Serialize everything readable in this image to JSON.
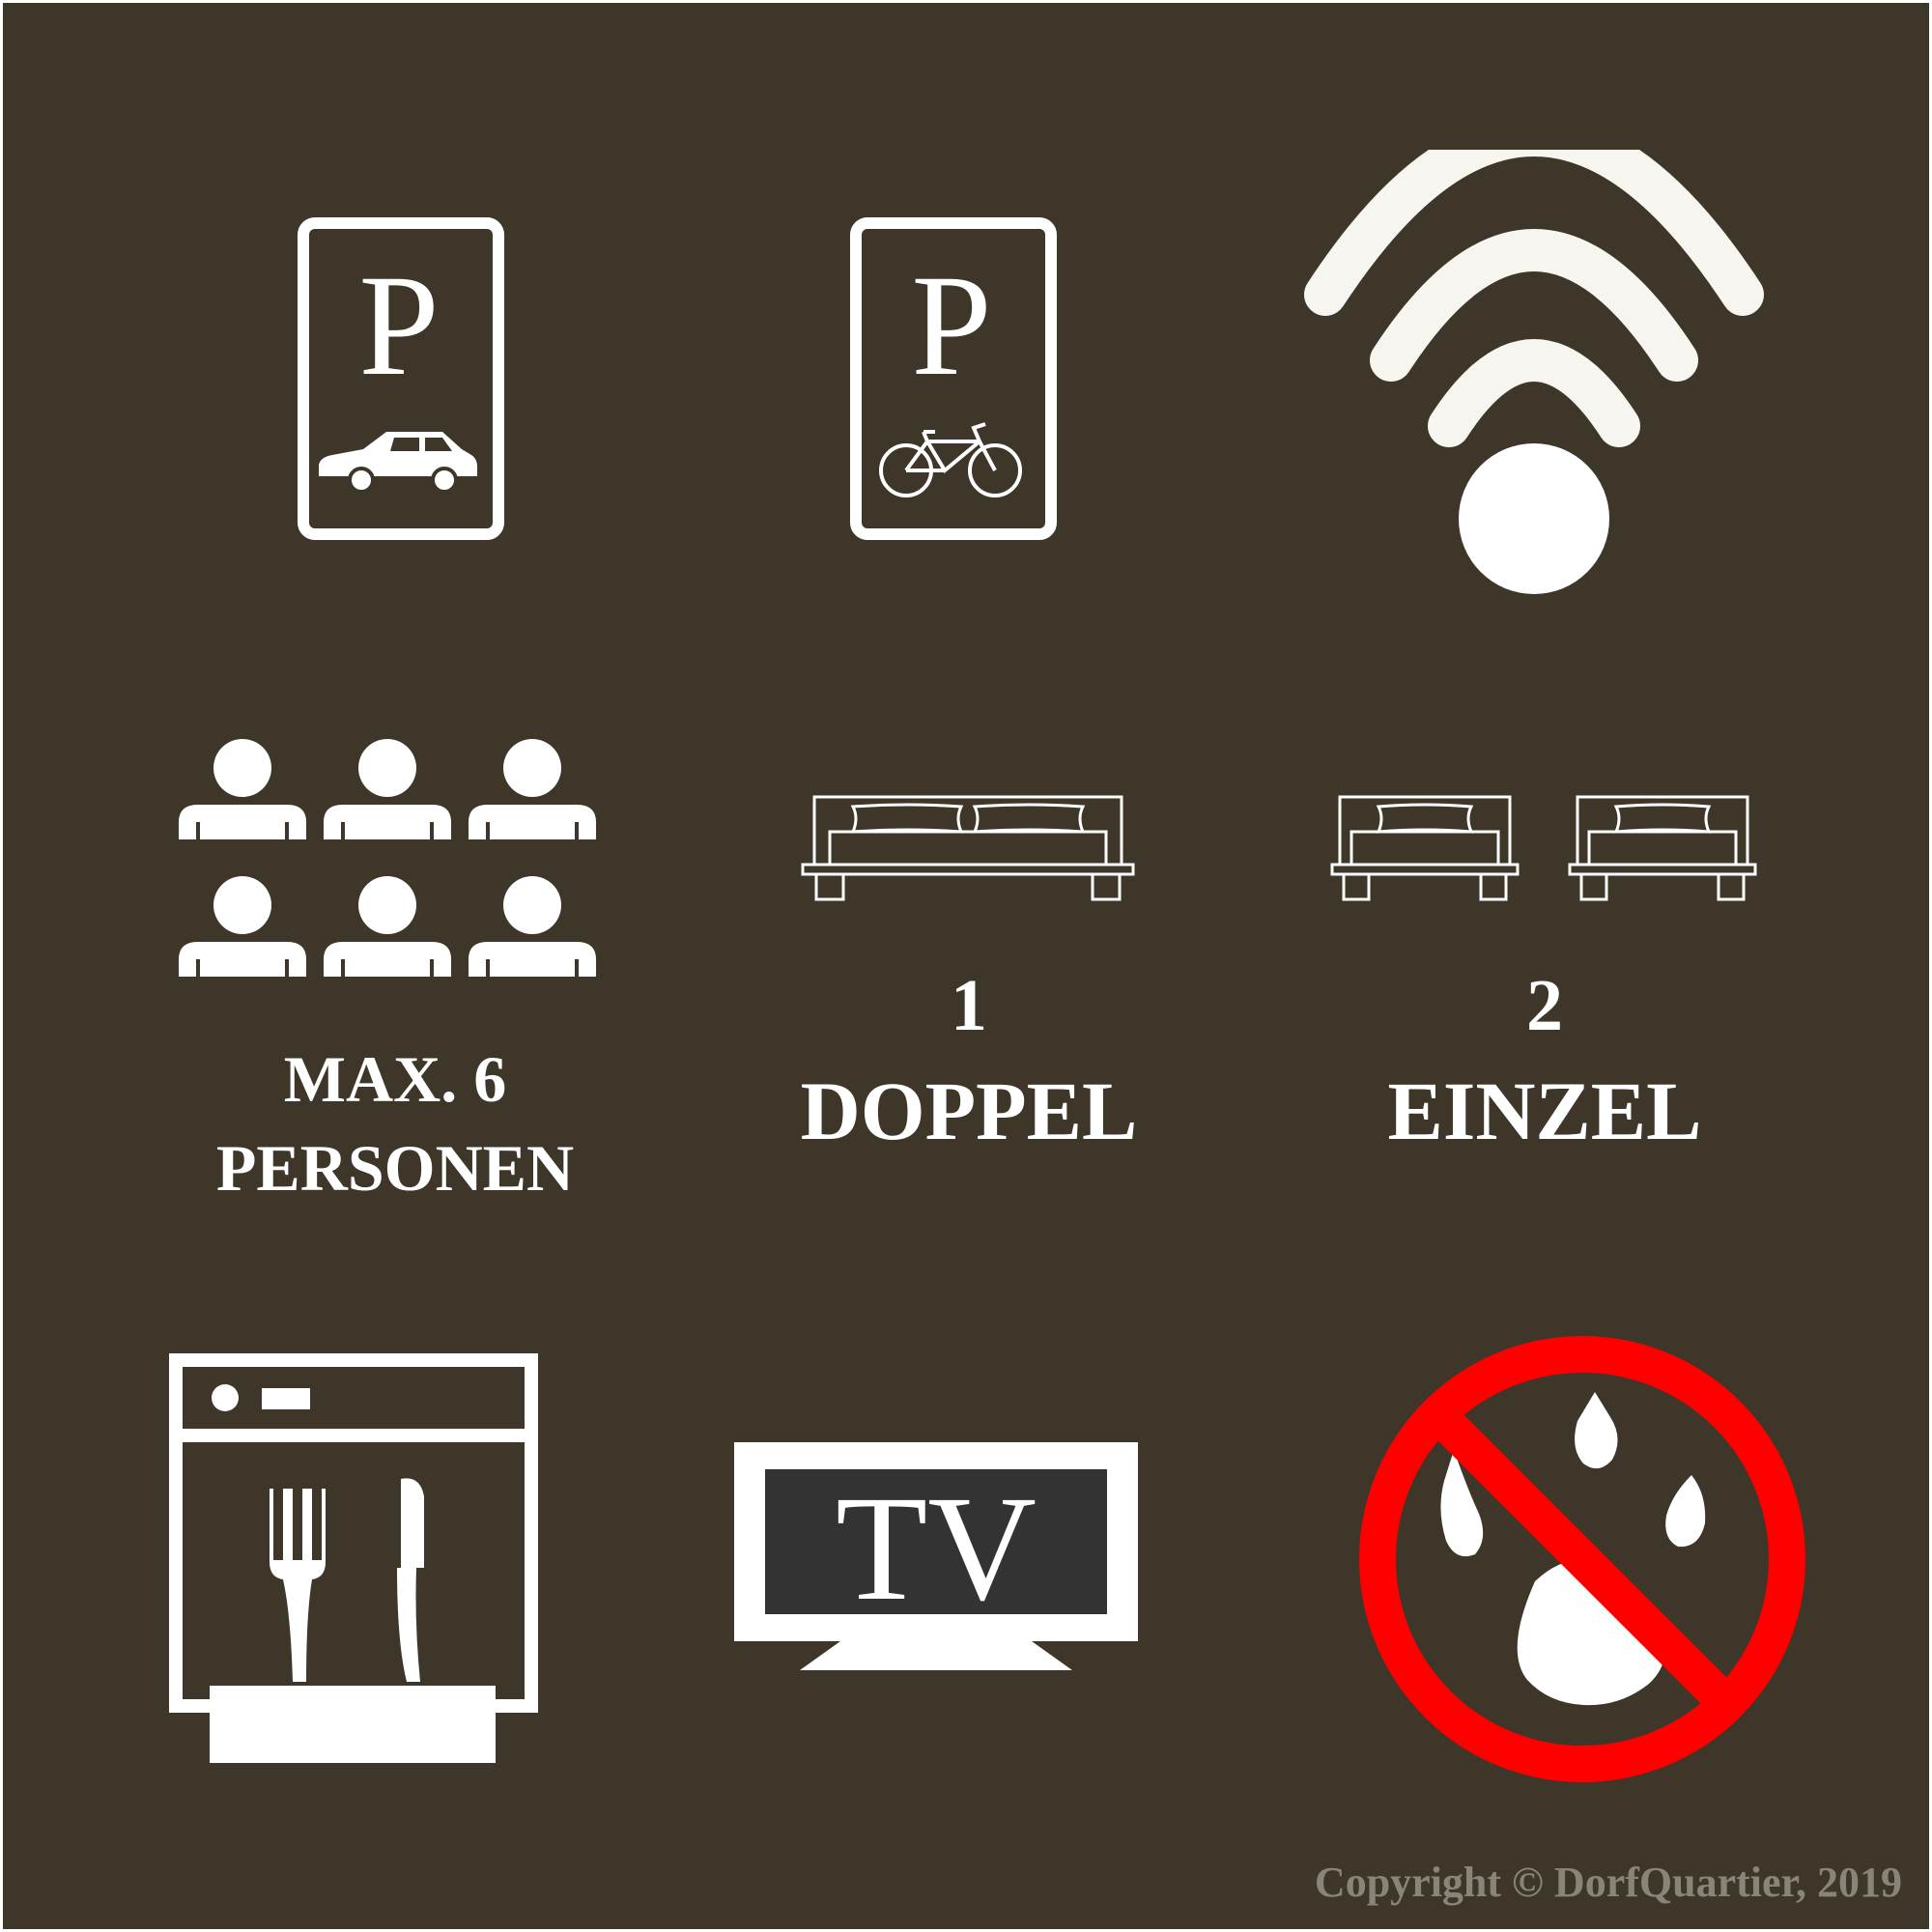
{
  "colors": {
    "background": "#3d3629",
    "icon": "#ffffff",
    "prohibition": "#ff0000",
    "tv_screen": "#333333",
    "copyright": "#8a8478"
  },
  "icons": {
    "car_parking": "car-parking-icon",
    "bike_parking": "bike-parking-icon",
    "wifi": "wifi-icon",
    "persons": "persons-group-icon",
    "double_bed": "double-bed-icon",
    "single_beds": "single-bed-icon",
    "dishwasher": "dishwasher-icon",
    "tv": "tv-icon",
    "no_pets": "no-pets-icon"
  },
  "signs": {
    "parking_letter": "P",
    "tv_text": "TV"
  },
  "persons": {
    "line1": "MAX. 6",
    "line2": "PERSONEN",
    "count": 6
  },
  "double_bed": {
    "number": "1",
    "label": "DOPPEL"
  },
  "single_beds": {
    "number": "2",
    "label": "EINZEL"
  },
  "copyright": "Copyright © DorfQuartier, 2019"
}
